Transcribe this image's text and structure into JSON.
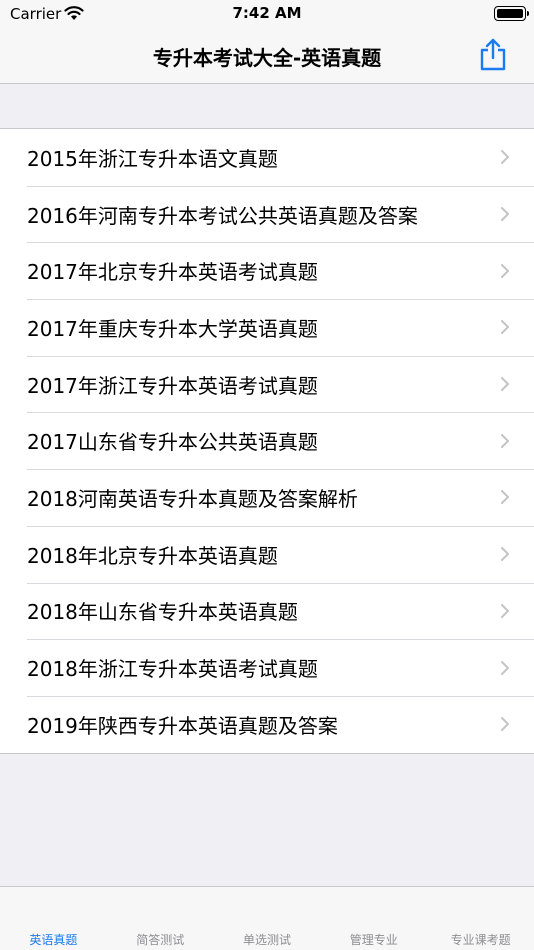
{
  "status": {
    "carrier": "Carrier",
    "time": "7:42 AM"
  },
  "nav": {
    "title": "专升本考试大全-英语真题",
    "share_icon": "share-icon"
  },
  "list": {
    "items": [
      {
        "label": "2015年浙江专升本语文真题"
      },
      {
        "label": "2016年河南专升本考试公共英语真题及答案"
      },
      {
        "label": "2017年北京专升本英语考试真题"
      },
      {
        "label": "2017年重庆专升本大学英语真题"
      },
      {
        "label": "2017年浙江专升本英语考试真题"
      },
      {
        "label": "2017山东省专升本公共英语真题"
      },
      {
        "label": "2018河南英语专升本真题及答案解析"
      },
      {
        "label": "2018年北京专升本英语真题"
      },
      {
        "label": "2018年山东省专升本英语真题"
      },
      {
        "label": "2018年浙江专升本英语考试真题"
      },
      {
        "label": "2019年陕西专升本英语真题及答案"
      }
    ]
  },
  "tabs": [
    {
      "label": "英语真题",
      "active": true
    },
    {
      "label": "简答测试",
      "active": false
    },
    {
      "label": "单选测试",
      "active": false
    },
    {
      "label": "管理专业",
      "active": false
    },
    {
      "label": "专业课考题",
      "active": false
    }
  ],
  "colors": {
    "accent": "#1a7cf0",
    "inactive_tab": "#8e8e93",
    "background": "#efeff4"
  }
}
